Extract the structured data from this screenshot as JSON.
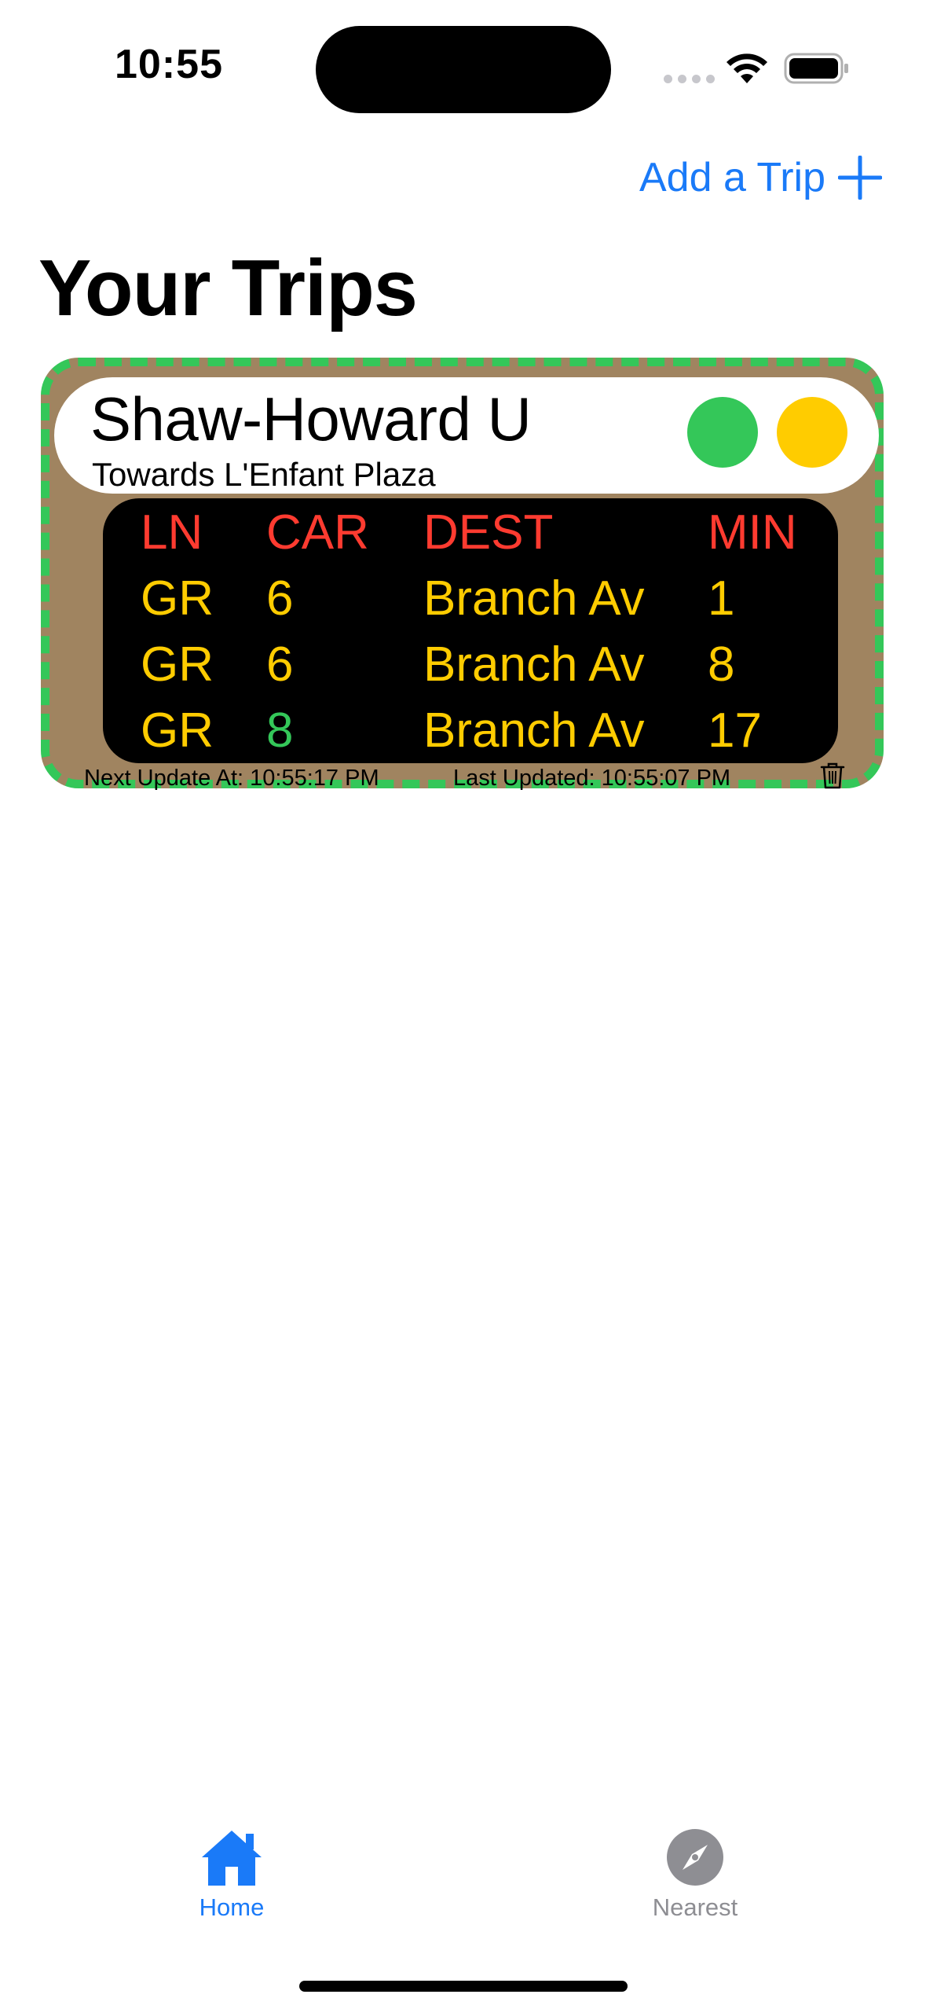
{
  "status_bar": {
    "time": "10:55"
  },
  "header": {
    "add_trip_label": "Add a Trip",
    "title": "Your Trips"
  },
  "trip": {
    "station": "Shaw-Howard U",
    "direction": "Towards L'Enfant Plaza",
    "indicator_colors": [
      "#34c759",
      "#ffcc00"
    ],
    "card_color": "#a08460",
    "border_color": "#34c759",
    "columns": {
      "ln": "LN",
      "car": "CAR",
      "dest": "DEST",
      "min": "MIN"
    },
    "arrivals": [
      {
        "ln": "GR",
        "car": "6",
        "dest": "Branch Av",
        "min": "1",
        "car_color": "#ffcc00"
      },
      {
        "ln": "GR",
        "car": "6",
        "dest": "Branch Av",
        "min": "8",
        "car_color": "#ffcc00"
      },
      {
        "ln": "GR",
        "car": "8",
        "dest": "Branch Av",
        "min": "17",
        "car_color": "#34c759"
      }
    ],
    "next_update": "Next Update At: 10:55:17 PM",
    "last_updated": "Last Updated: 10:55:07 PM"
  },
  "tabs": [
    {
      "label": "Home",
      "icon": "home-icon",
      "active": true
    },
    {
      "label": "Nearest",
      "icon": "compass-icon",
      "active": false
    }
  ],
  "colors": {
    "accent": "#1a7af8",
    "header_text": "#ff3b30",
    "board_text": "#ffcc00"
  }
}
